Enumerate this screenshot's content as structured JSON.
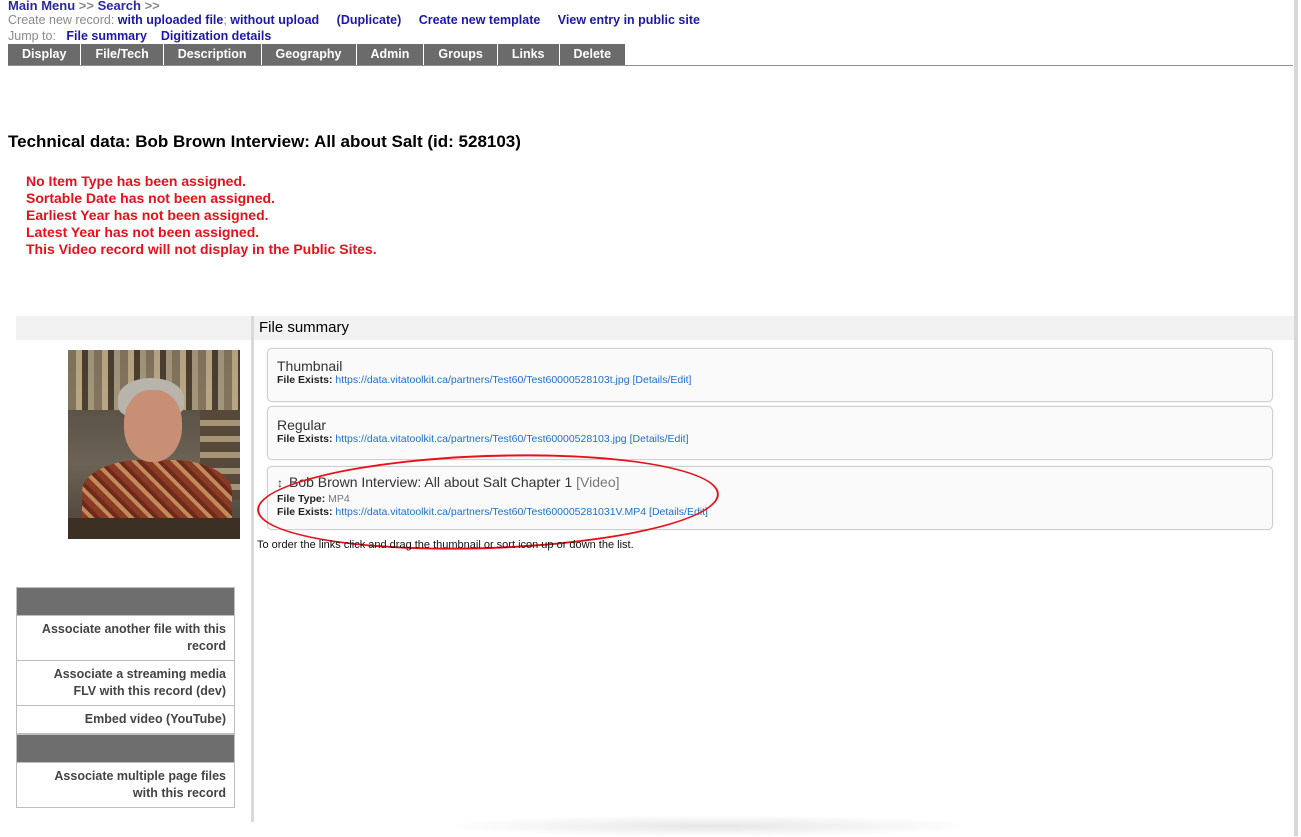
{
  "nav": {
    "main_menu": "Main Menu",
    "sep1": " >> ",
    "search": "Search",
    "sep2": " >>"
  },
  "create": {
    "prefix": "Create new record: ",
    "with_upload": "with uploaded file",
    "semi": "; ",
    "without_upload": "without upload",
    "duplicate": "(Duplicate)",
    "new_template": "Create new template",
    "view_public": "View entry in public site"
  },
  "jump": {
    "prefix": "Jump to:",
    "file_summary": "File summary",
    "digitization": "Digitization details"
  },
  "tabs": [
    "Display",
    "File/Tech",
    "Description",
    "Geography",
    "Admin",
    "Groups",
    "Links",
    "Delete"
  ],
  "page_title": "Technical data: Bob Brown Interview: All about Salt (id: 528103)",
  "warnings": [
    "No Item Type has been assigned.",
    "Sortable Date has not been assigned.",
    "Earliest Year has not been assigned.",
    "Latest Year has not been assigned.",
    "This Video record will not display in the Public Sites."
  ],
  "file_summary": {
    "title": "File summary",
    "cards": [
      {
        "title": "Thumbnail",
        "exists_label": "File Exists:",
        "url": "https://data.vitatoolkit.ca/partners/Test60/Test60000528103t.jpg",
        "details": "[Details/Edit]"
      },
      {
        "title": "Regular",
        "exists_label": "File Exists:",
        "url": "https://data.vitatoolkit.ca/partners/Test60/Test60000528103.jpg",
        "details": "[Details/Edit]"
      },
      {
        "sort_icon": "↕",
        "title": "Bob Brown Interview: All about Salt Chapter 1",
        "kind": "[Video]",
        "type_label": "File Type:",
        "type_value": "MP4",
        "exists_label": "File Exists:",
        "url": "https://data.vitatoolkit.ca/partners/Test60/Test600005281031V.MP4",
        "details": "[Details/Edit]"
      }
    ],
    "hint": "To order the links click and drag the thumbnail or sort icon up or down the list."
  },
  "sidebar": {
    "items": [
      "Associate another file with this record",
      "Associate a streaming media FLV with this record (dev)",
      "Embed video (YouTube)",
      "Associate multiple page files with this record"
    ]
  }
}
